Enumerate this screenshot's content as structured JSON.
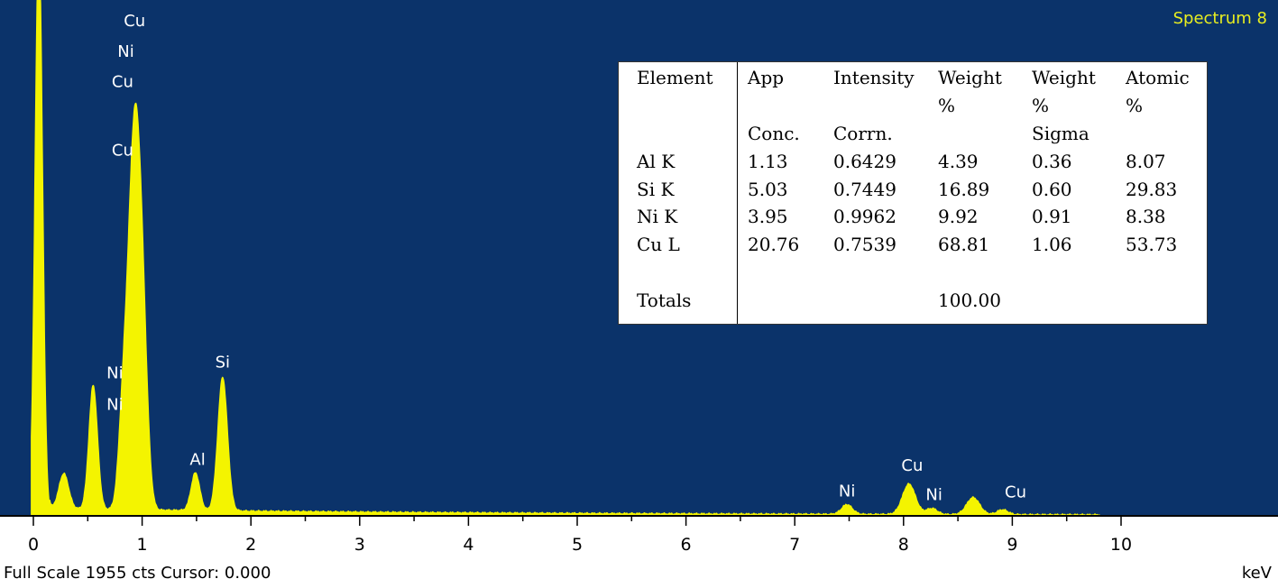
{
  "title": "Spectrum 8",
  "status": "Full Scale 1955 cts Cursor: 0.000",
  "x_unit": "keV",
  "colors": {
    "background": "#0b336a",
    "spectrum": "#f4f400",
    "axis": "#000000",
    "label": "#ffffff",
    "title": "#e8ee20"
  },
  "chart_data": {
    "type": "area",
    "title": "Spectrum 8",
    "xlabel": "keV",
    "xlim": [
      -0.3,
      11.0
    ],
    "x_ticks": [
      "0",
      "1",
      "2",
      "3",
      "4",
      "5",
      "6",
      "7",
      "8",
      "9",
      "10"
    ],
    "full_scale_counts": 1955,
    "peaks": [
      {
        "x": 0.05,
        "height": 2400,
        "width": 0.035
      },
      {
        "x": 0.28,
        "height": 145,
        "width": 0.045
      },
      {
        "x": 0.55,
        "height": 510,
        "width": 0.04
      },
      {
        "x": 0.82,
        "height": 300,
        "width": 0.04
      },
      {
        "x": 0.93,
        "height": 1560,
        "width": 0.06
      },
      {
        "x": 1.01,
        "height": 430,
        "width": 0.045
      },
      {
        "x": 1.49,
        "height": 155,
        "width": 0.04
      },
      {
        "x": 1.74,
        "height": 550,
        "width": 0.045
      },
      {
        "x": 7.48,
        "height": 40,
        "width": 0.05
      },
      {
        "x": 8.05,
        "height": 125,
        "width": 0.06
      },
      {
        "x": 8.26,
        "height": 25,
        "width": 0.05
      },
      {
        "x": 8.64,
        "height": 70,
        "width": 0.06
      },
      {
        "x": 8.91,
        "height": 20,
        "width": 0.05
      }
    ],
    "background": {
      "max": 28,
      "decay": 0.25,
      "end": 9.8
    },
    "peak_labels": [
      {
        "text": "Cu",
        "x": 0.93,
        "y": 2010
      },
      {
        "text": "Ni",
        "x": 0.85,
        "y": 1885
      },
      {
        "text": "Cu",
        "x": 0.82,
        "y": 1760
      },
      {
        "text": "Cu",
        "x": 0.82,
        "y": 1480
      },
      {
        "text": "Ni",
        "x": 0.75,
        "y": 565
      },
      {
        "text": "Ni",
        "x": 0.75,
        "y": 435
      },
      {
        "text": "Al",
        "x": 1.51,
        "y": 210
      },
      {
        "text": "Si",
        "x": 1.74,
        "y": 610
      },
      {
        "text": "Ni",
        "x": 7.48,
        "y": 80
      },
      {
        "text": "Cu",
        "x": 8.08,
        "y": 185
      },
      {
        "text": "Ni",
        "x": 8.28,
        "y": 65
      },
      {
        "text": "Cu",
        "x": 9.03,
        "y": 75
      }
    ]
  },
  "table": {
    "headers": [
      [
        "Element"
      ],
      [
        "App",
        "",
        "Conc."
      ],
      [
        "Intensity",
        "",
        "Corrn."
      ],
      [
        "Weight",
        "%",
        ""
      ],
      [
        "Weight",
        "%",
        "Sigma"
      ],
      [
        "Atomic",
        "%",
        ""
      ]
    ],
    "rows": [
      [
        "Al K",
        "1.13",
        "0.6429",
        "4.39",
        "0.36",
        "8.07"
      ],
      [
        "Si K",
        "5.03",
        "0.7449",
        "16.89",
        "0.60",
        "29.83"
      ],
      [
        "Ni K",
        "3.95",
        "0.9962",
        "9.92",
        "0.91",
        "8.38"
      ],
      [
        "Cu L",
        "20.76",
        "0.7539",
        "68.81",
        "1.06",
        "53.73"
      ]
    ],
    "totals_label": "Totals",
    "totals_weight": "100.00"
  }
}
